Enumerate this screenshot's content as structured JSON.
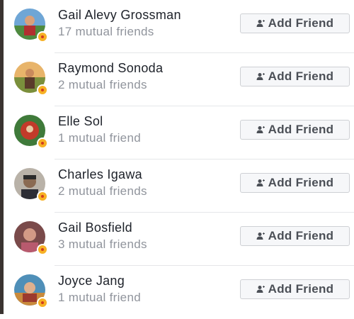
{
  "friend_suggestions": {
    "button_label": "Add Friend",
    "icon": "add-friend-icon",
    "items": [
      {
        "name": "Gail Alevy Grossman",
        "mutual": "17 mutual friends"
      },
      {
        "name": "Raymond Sonoda",
        "mutual": "2 mutual friends"
      },
      {
        "name": "Elle Sol",
        "mutual": "1 mutual friend"
      },
      {
        "name": "Charles Igawa",
        "mutual": "2 mutual friends"
      },
      {
        "name": "Gail Bosfield",
        "mutual": "3 mutual friends"
      },
      {
        "name": "Joyce Jang",
        "mutual": "1 mutual friend"
      }
    ]
  }
}
